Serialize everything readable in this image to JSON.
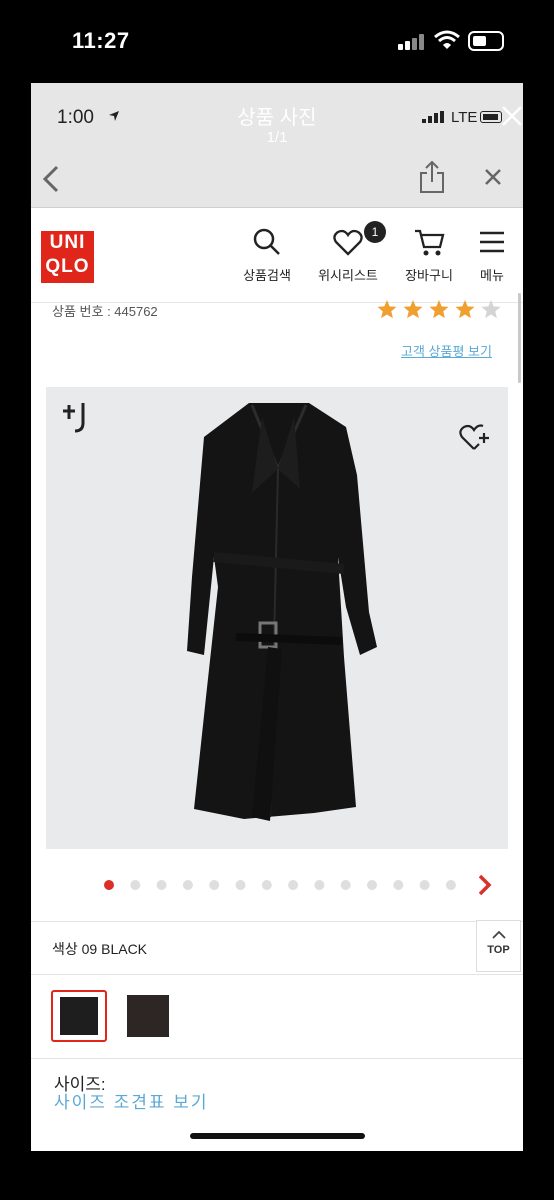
{
  "outer_status": {
    "time": "11:27"
  },
  "viewer": {
    "inner_time": "1:00",
    "title": "상품 사진",
    "count": "1/1",
    "network": "LTE"
  },
  "brand": {
    "logo_line1": "UNI",
    "logo_line2": "QLO",
    "logo_color": "#e0261b"
  },
  "nav": {
    "search": "상품검색",
    "wishlist": "위시리스트",
    "wishlist_count": "1",
    "cart": "장바구니",
    "menu": "메뉴"
  },
  "product": {
    "number_label": "상품 번호 : 445762",
    "rating": 4,
    "rating_max": 5,
    "review_link": "고객 상품평 보기",
    "plusj_logo": "+J"
  },
  "carousel": {
    "total": 14,
    "active": 0
  },
  "color": {
    "label": "색상 09 BLACK",
    "swatches": [
      {
        "name": "black",
        "hex": "#1e1e1e",
        "selected": true
      },
      {
        "name": "dark brown",
        "hex": "#2e2624",
        "selected": false
      }
    ]
  },
  "top_button": "TOP",
  "size": {
    "label": "사이즈:",
    "chart_link": "사이즈 조견표 보기"
  },
  "colors": {
    "accent": "#e0261b",
    "link": "#5aa9d4",
    "star": "#f0a030"
  }
}
